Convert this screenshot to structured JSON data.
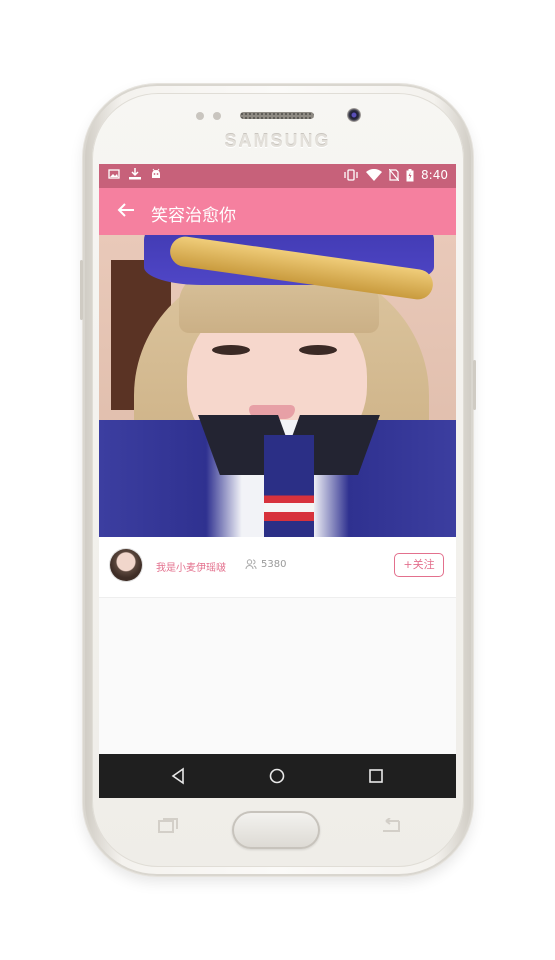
{
  "device": {
    "brand": "SAMSUNG"
  },
  "status_bar": {
    "time": "8:40",
    "left_icons": [
      "image-icon",
      "download-icon",
      "android-icon"
    ],
    "right_icons": [
      "vibrate-icon",
      "wifi-icon",
      "no-sim-icon",
      "battery-icon"
    ],
    "background": "#c7617a"
  },
  "app_bar": {
    "title": "笑容治愈你",
    "background": "#f5809f"
  },
  "streamer": {
    "name": "我是小麦伊瑶啵",
    "viewer_count": "5380",
    "follow_label": "+关注",
    "accent": "#e3708d"
  },
  "nav_bar": {
    "buttons": [
      "back-icon",
      "home-icon",
      "recents-icon"
    ]
  }
}
